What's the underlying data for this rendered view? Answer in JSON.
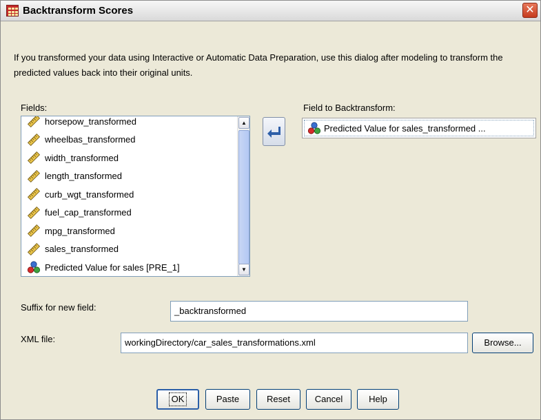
{
  "window": {
    "title": "Backtransform Scores",
    "close_glyph": "✕"
  },
  "description": "If you transformed your data using Interactive or Automatic Data Preparation, use this dialog after modeling to transform the predicted values back into their original units.",
  "fields": {
    "label": "Fields:",
    "items": [
      {
        "label": "horsepow_transformed",
        "icon": "ruler-icon"
      },
      {
        "label": "wheelbas_transformed",
        "icon": "ruler-icon"
      },
      {
        "label": "width_transformed",
        "icon": "ruler-icon"
      },
      {
        "label": "length_transformed",
        "icon": "ruler-icon"
      },
      {
        "label": "curb_wgt_transformed",
        "icon": "ruler-icon"
      },
      {
        "label": "fuel_cap_transformed",
        "icon": "ruler-icon"
      },
      {
        "label": "mpg_transformed",
        "icon": "ruler-icon"
      },
      {
        "label": "sales_transformed",
        "icon": "ruler-icon"
      },
      {
        "label": "Predicted Value for sales [PRE_1]",
        "icon": "nominal-icon"
      }
    ]
  },
  "target": {
    "label": "Field to Backtransform:",
    "value": "Predicted Value for sales_transformed ...",
    "icon": "nominal-icon"
  },
  "suffix": {
    "label": "Suffix for new field:",
    "value": "_backtransformed"
  },
  "xml": {
    "label": "XML file:",
    "value": "workingDirectory/car_sales_transformations.xml",
    "browse_label": "Browse..."
  },
  "buttons": {
    "ok": "OK",
    "paste": "Paste",
    "reset": "Reset",
    "cancel": "Cancel",
    "help": "Help"
  },
  "colors": {
    "dialog_bg": "#ece9d8",
    "scroll_thumb": "#b3c8f3",
    "close_red": "#c53b1e"
  }
}
